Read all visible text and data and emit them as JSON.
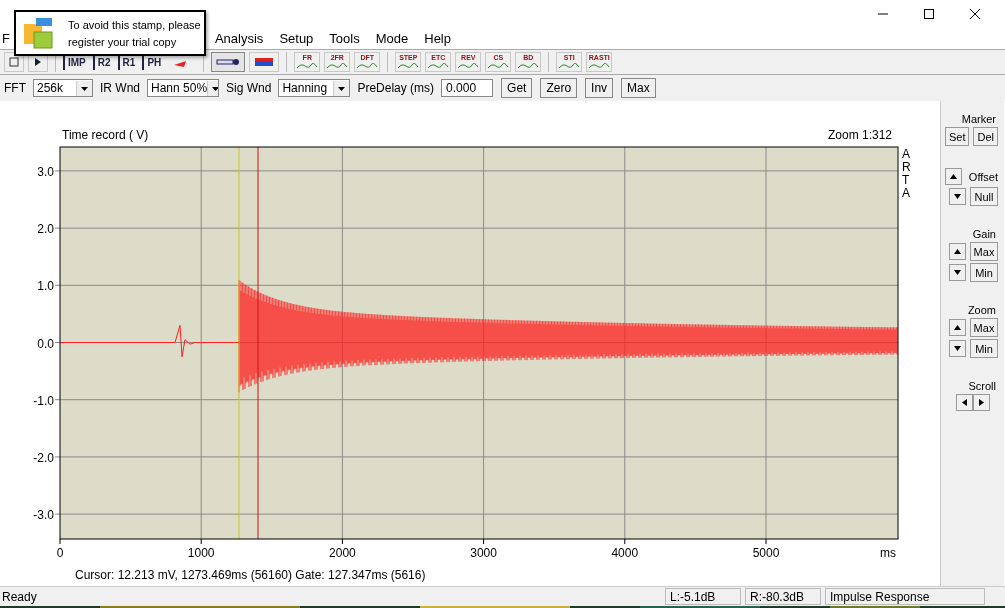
{
  "menu": {
    "items": [
      "F",
      "Analysis",
      "Setup",
      "Tools",
      "Mode",
      "Help"
    ]
  },
  "stamp": {
    "lines": [
      "To avoid this stamp, please",
      "register your trial copy"
    ]
  },
  "toolbar": {
    "measure_tools": [
      "IMP",
      "R2",
      "R1",
      "PH"
    ],
    "analysis_groups": [
      [
        "FR",
        "2FR",
        "DFT"
      ],
      [
        "STEP",
        "ETC",
        "REV",
        "CS",
        "BD"
      ],
      [
        "STI",
        "RASTI"
      ]
    ]
  },
  "settings": {
    "fft": {
      "label": "FFT",
      "value": "256k"
    },
    "ir_wnd": {
      "label": "IR Wnd",
      "value": "Hann 50%"
    },
    "sig_wnd": {
      "label": "Sig Wnd",
      "value": "Hanning"
    },
    "predelay": {
      "label": "PreDelay (ms)",
      "value": "0.000"
    },
    "buttons": [
      "Get",
      "Zero",
      "Inv",
      "Max"
    ]
  },
  "plot": {
    "title": "Time record ( V)",
    "zoom": "Zoom 1:312",
    "side_label": "ARTA",
    "y_ticks": [
      "3.0",
      "2.0",
      "1.0",
      "0.0",
      "-1.0",
      "-2.0",
      "-3.0"
    ],
    "x_ticks": [
      "0",
      "1000",
      "2000",
      "3000",
      "4000",
      "5000"
    ],
    "x_unit": "ms",
    "readout": "Cursor: 12.213 mV, 1273.469ms (56160)  Gate: 127.347ms (5616)"
  },
  "side_panel": {
    "marker": {
      "label": "Marker",
      "buttons": [
        "Set",
        "Del"
      ]
    },
    "offset": {
      "label": "Offset",
      "button": "Null"
    },
    "gain": {
      "label": "Gain",
      "buttons": [
        "Max",
        "Min"
      ]
    },
    "zoom": {
      "label": "Zoom",
      "buttons": [
        "Max",
        "Min"
      ]
    },
    "scroll": {
      "label": "Scroll"
    }
  },
  "status_bar": {
    "message": "Ready",
    "panels": [
      "L:-5.1dB",
      "R:-80.3dB",
      "Impulse Response"
    ]
  }
}
